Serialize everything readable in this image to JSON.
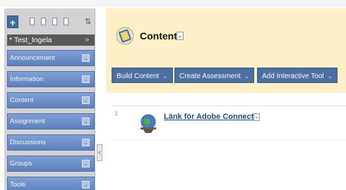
{
  "sidebar": {
    "add_symbol": "+",
    "sort_symbol": "⇅",
    "course_name": "* Test_Ingela",
    "course_arrow": "»",
    "chevron": "⌄",
    "items": [
      {
        "label": "Announcement"
      },
      {
        "label": "Information"
      },
      {
        "label": "Content"
      },
      {
        "label": "Assignment"
      },
      {
        "label": "Discussions"
      },
      {
        "label": "Groups"
      },
      {
        "label": "Tools"
      }
    ],
    "collapse_symbol": "‹"
  },
  "page": {
    "title": "Content",
    "title_chevron": "⌄"
  },
  "toolbar": {
    "build_content": "Build Content",
    "create_assessment": "Create Assessment",
    "add_interactive_tool": "Add Interactive Tool",
    "dropdown_symbol": "⌄"
  },
  "content_item": {
    "drag_symbol": "↕",
    "title": "Länk för Adobe Connect",
    "chevron": "⌄"
  },
  "colors": {
    "header_bg": "#fdf0c6",
    "menu_blue": "#6f8fcb",
    "toolbar_blue": "#4a6fa0",
    "link_blue": "#1e4d8f"
  }
}
